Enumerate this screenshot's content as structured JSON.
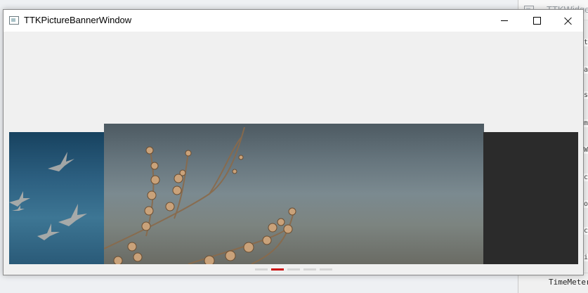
{
  "background_window": {
    "title": "TTKWidgetT",
    "right_edge_glyphs": [
      "t",
      "a",
      "s",
      "m",
      "W",
      "c",
      "o",
      "c",
      "i"
    ],
    "bottom_label": "TimeMeterW"
  },
  "window": {
    "title": "TTKPictureBannerWindow",
    "controls": {
      "minimize_icon": "minimize-icon",
      "maximize_icon": "maximize-icon",
      "close_icon": "close-icon"
    }
  },
  "banner": {
    "slides": [
      {
        "name": "birds-photo",
        "position": "left"
      },
      {
        "name": "dried-branch-photo",
        "position": "center"
      },
      {
        "name": "dark-photo",
        "position": "right"
      }
    ],
    "pager": {
      "count": 5,
      "active_index": 1,
      "active_color": "#cc1111",
      "inactive_color": "#d6d6d6"
    }
  }
}
